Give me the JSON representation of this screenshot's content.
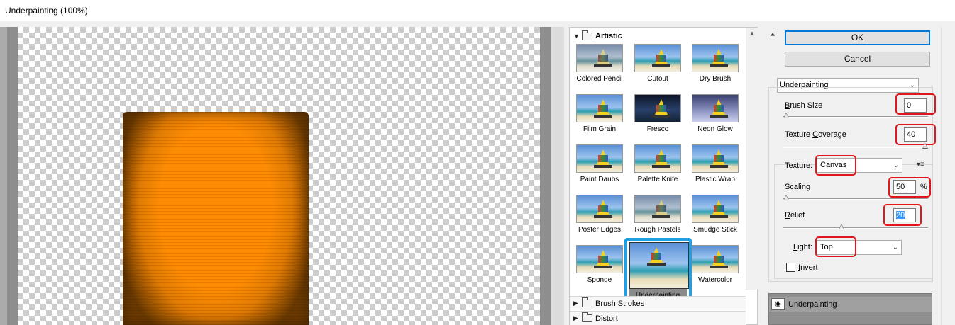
{
  "window": {
    "title": "Underpainting (100%)"
  },
  "gallery": {
    "open_category": "Artistic",
    "thumbs": [
      {
        "label": "Colored Pencil"
      },
      {
        "label": "Cutout"
      },
      {
        "label": "Dry Brush"
      },
      {
        "label": "Film Grain"
      },
      {
        "label": "Fresco"
      },
      {
        "label": "Neon Glow"
      },
      {
        "label": "Paint Daubs"
      },
      {
        "label": "Palette Knife"
      },
      {
        "label": "Plastic Wrap"
      },
      {
        "label": "Poster Edges"
      },
      {
        "label": "Rough Pastels"
      },
      {
        "label": "Smudge Stick"
      },
      {
        "label": "Sponge"
      },
      {
        "label": "Underpainting"
      },
      {
        "label": "Watercolor"
      }
    ],
    "selected": "Underpainting",
    "closed_categories": [
      "Brush Strokes",
      "Distort"
    ]
  },
  "buttons": {
    "ok": "OK",
    "cancel": "Cancel"
  },
  "filter_select": {
    "value": "Underpainting"
  },
  "settings": {
    "brush_size": {
      "label_pre": "",
      "label_ul": "B",
      "label_post": "rush Size",
      "value": "0",
      "slider": 0.0
    },
    "texture_coverage": {
      "label_pre": "Texture ",
      "label_ul": "C",
      "label_post": "overage",
      "value": "40",
      "slider": 1.0
    },
    "texture": {
      "label_pre": "",
      "label_ul": "T",
      "label_post": "exture:",
      "value": "Canvas"
    },
    "scaling": {
      "label_pre": "",
      "label_ul": "S",
      "label_post": "caling",
      "value": "50",
      "unit": "%",
      "slider": 0.0
    },
    "relief": {
      "label_pre": "",
      "label_ul": "R",
      "label_post": "elief",
      "value": "20",
      "slider": 0.4
    },
    "light": {
      "label_pre": "",
      "label_ul": "L",
      "label_post": "ight:",
      "value": "Top"
    },
    "invert": {
      "label_pre": "",
      "label_ul": "I",
      "label_post": "nvert",
      "checked": false
    }
  },
  "layers": {
    "active": "Underpainting"
  },
  "icons": {
    "collapse": "double-chevron-up-icon",
    "eye": "eye-icon",
    "dropdown": "chevron-down-icon",
    "texture_menu": "menu-icon"
  },
  "colors": {
    "selection_highlight": "#1ea0e6",
    "annotation_red": "#e0161c",
    "orange_fill": "#ff8c00"
  }
}
